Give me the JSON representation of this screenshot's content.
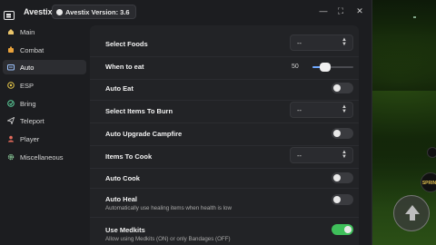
{
  "app": {
    "title": "Avestix",
    "version_label": "Avestix Version: 3.6"
  },
  "window_controls": {
    "minimize": "—",
    "maximize": "⛶",
    "close": "✕"
  },
  "sidebar": {
    "items": [
      {
        "label": "Main",
        "icon": "home-icon",
        "active": false
      },
      {
        "label": "Combat",
        "icon": "sword-icon",
        "active": false
      },
      {
        "label": "Auto",
        "icon": "robot-icon",
        "active": true
      },
      {
        "label": "ESP",
        "icon": "eye-icon",
        "active": false
      },
      {
        "label": "Bring",
        "icon": "hand-icon",
        "active": false
      },
      {
        "label": "Teleport",
        "icon": "send-icon",
        "active": false
      },
      {
        "label": "Player",
        "icon": "user-icon",
        "active": false
      },
      {
        "label": "Miscellaneous",
        "icon": "gear-icon",
        "active": false
      }
    ]
  },
  "settings": {
    "select_foods": {
      "label": "Select Foods",
      "value": "--"
    },
    "when_to_eat": {
      "label": "When to eat",
      "value": "50",
      "fraction": 0.3
    },
    "auto_eat": {
      "label": "Auto Eat",
      "on": false
    },
    "select_items_burn": {
      "label": "Select Items To Burn",
      "value": "--"
    },
    "auto_upgrade_campfire": {
      "label": "Auto Upgrade Campfire",
      "on": false
    },
    "items_to_cook": {
      "label": "Items To Cook",
      "value": "--"
    },
    "auto_cook": {
      "label": "Auto Cook",
      "on": false
    },
    "auto_heal": {
      "label": "Auto Heal",
      "description": "Automatically use healing items when health is low",
      "on": false
    },
    "use_medkits": {
      "label": "Use Medkits",
      "description": "Allow using Medkits (ON) or only Bandages (OFF)",
      "on": true
    }
  },
  "hud": {
    "sprint_label": "SPRINT"
  },
  "colors": {
    "accent_toggle_on": "#3fbf5a",
    "panel_bg": "#222326",
    "window_bg": "#1c1d20"
  }
}
